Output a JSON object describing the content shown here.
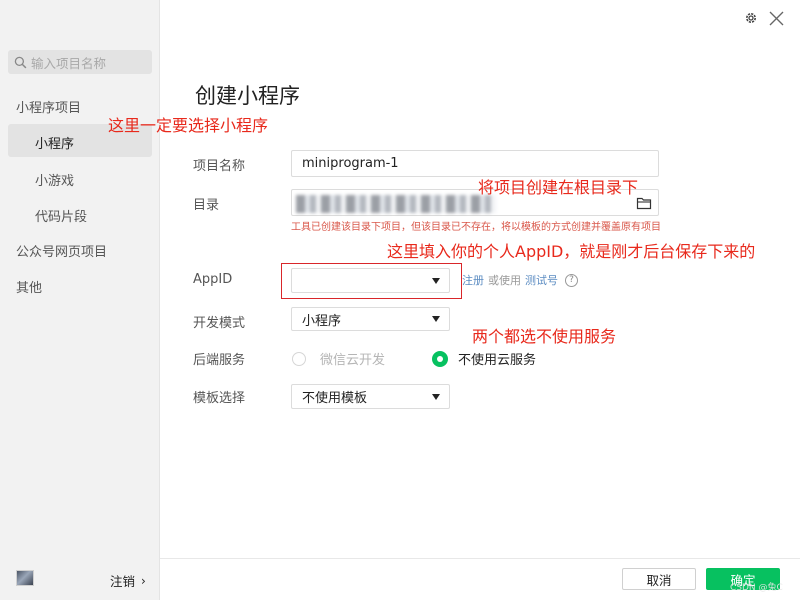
{
  "sidebar": {
    "search_placeholder": "输入项目名称",
    "section_miniprogram": "小程序项目",
    "items": [
      "小程序",
      "小游戏",
      "代码片段"
    ],
    "section_official": "公众号网页项目",
    "section_other": "其他",
    "logout_label": "注销",
    "logout_chevron": "›"
  },
  "title": "创建小程序",
  "form": {
    "project_name_label": "项目名称",
    "project_name_value": "miniprogram-1",
    "directory_label": "目录",
    "directory_hint": "工具已创建该目录下项目，但该目录已不存在，将以模板的方式创建并覆盖原有项目",
    "appid_label": "AppID",
    "appid_value": "",
    "register_link": "注册",
    "or_use_text": "或使用",
    "test_account_link": "测试号",
    "help_symbol": "?",
    "dev_mode_label": "开发模式",
    "dev_mode_value": "小程序",
    "backend_label": "后端服务",
    "backend_options": [
      "微信云开发",
      "不使用云服务"
    ],
    "backend_selected": "不使用云服务",
    "template_label": "模板选择",
    "template_value": "不使用模板"
  },
  "annotations": {
    "choose_miniprogram": "这里一定要选择小程序",
    "create_in_root": "将项目创建在根目录下",
    "fill_appid": "这里填入你的个人AppID，就是刚才后台保存下来的",
    "no_cloud": "两个都选不使用服务"
  },
  "footer": {
    "cancel_label": "取消",
    "confirm_label": "确定",
    "watermark": "CSDN @兔C"
  },
  "colors": {
    "accent_green": "#07c160",
    "annotation_red": "#e8291c",
    "link_blue": "#5b8cc2"
  },
  "icons": [
    "search-icon",
    "settings-icon",
    "close-icon",
    "folder-icon",
    "caret-down-icon",
    "help-icon",
    "chevron-right-icon"
  ]
}
